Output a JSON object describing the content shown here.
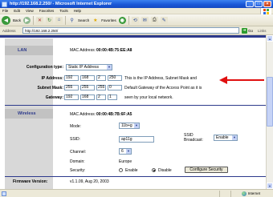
{
  "window": {
    "title": "http://192.168.2.250/ - Microsoft Internet Explorer",
    "buttons": [
      "_",
      "□",
      "×"
    ]
  },
  "menu": [
    "File",
    "Edit",
    "View",
    "Favorites",
    "Tools",
    "Help"
  ],
  "toolbar": {
    "back_label": "Back",
    "search_label": "Search",
    "favorites_label": "Favorites"
  },
  "address": {
    "label": "Address",
    "url": "http://192.168.2.250/",
    "go_label": "Go",
    "links_label": "Links"
  },
  "lan": {
    "section_title": "LAN",
    "mac_label": "MAC Address:",
    "mac_value": "00:00:4B:75:EE:A8",
    "config_type_label": "Configuration type:",
    "config_type_value": "Static IP Address",
    "ip_label": "IP Address:",
    "ip": [
      "192",
      "168",
      "2",
      "250"
    ],
    "ip_note": "This is the IP Address, Subnet Mask and",
    "subnet_label": "Subnet Mask:",
    "subnet": [
      "255",
      "255",
      "255",
      "0"
    ],
    "subnet_note": "Default Gateway of the Access Point as it is",
    "gateway_label": "Gateway:",
    "gateway": [
      "192",
      "168",
      "2",
      "1"
    ],
    "gateway_note": "seen by your local network."
  },
  "wireless": {
    "section_title": "Wireless",
    "mac_label": "MAC Address:",
    "mac_value": "00:00:4B:7B:6F:A5",
    "mode_label": "Mode:",
    "mode_value": "11b+g",
    "ssid_label": "SSID:",
    "ssid_value": "ap11g",
    "ssid_broadcast_label": "SSID Broadcast:",
    "ssid_broadcast_value": "Enable",
    "channel_label": "Channel:",
    "channel_value": "6",
    "domain_label": "Domain:",
    "domain_value": "Europe",
    "security_label": "Security:",
    "security_options": [
      "Enable",
      "Disable"
    ],
    "security_selected": "Disable",
    "configure_button": "Configure Security"
  },
  "firmware": {
    "label": "Firmware Version:",
    "value": "v1.1.09, Aug 20, 2003"
  },
  "status": {
    "zone": "Internet"
  },
  "colors": {
    "accent": "#2d3a8c",
    "arrow": "#e01010",
    "label_column": "#d8d8d8"
  }
}
